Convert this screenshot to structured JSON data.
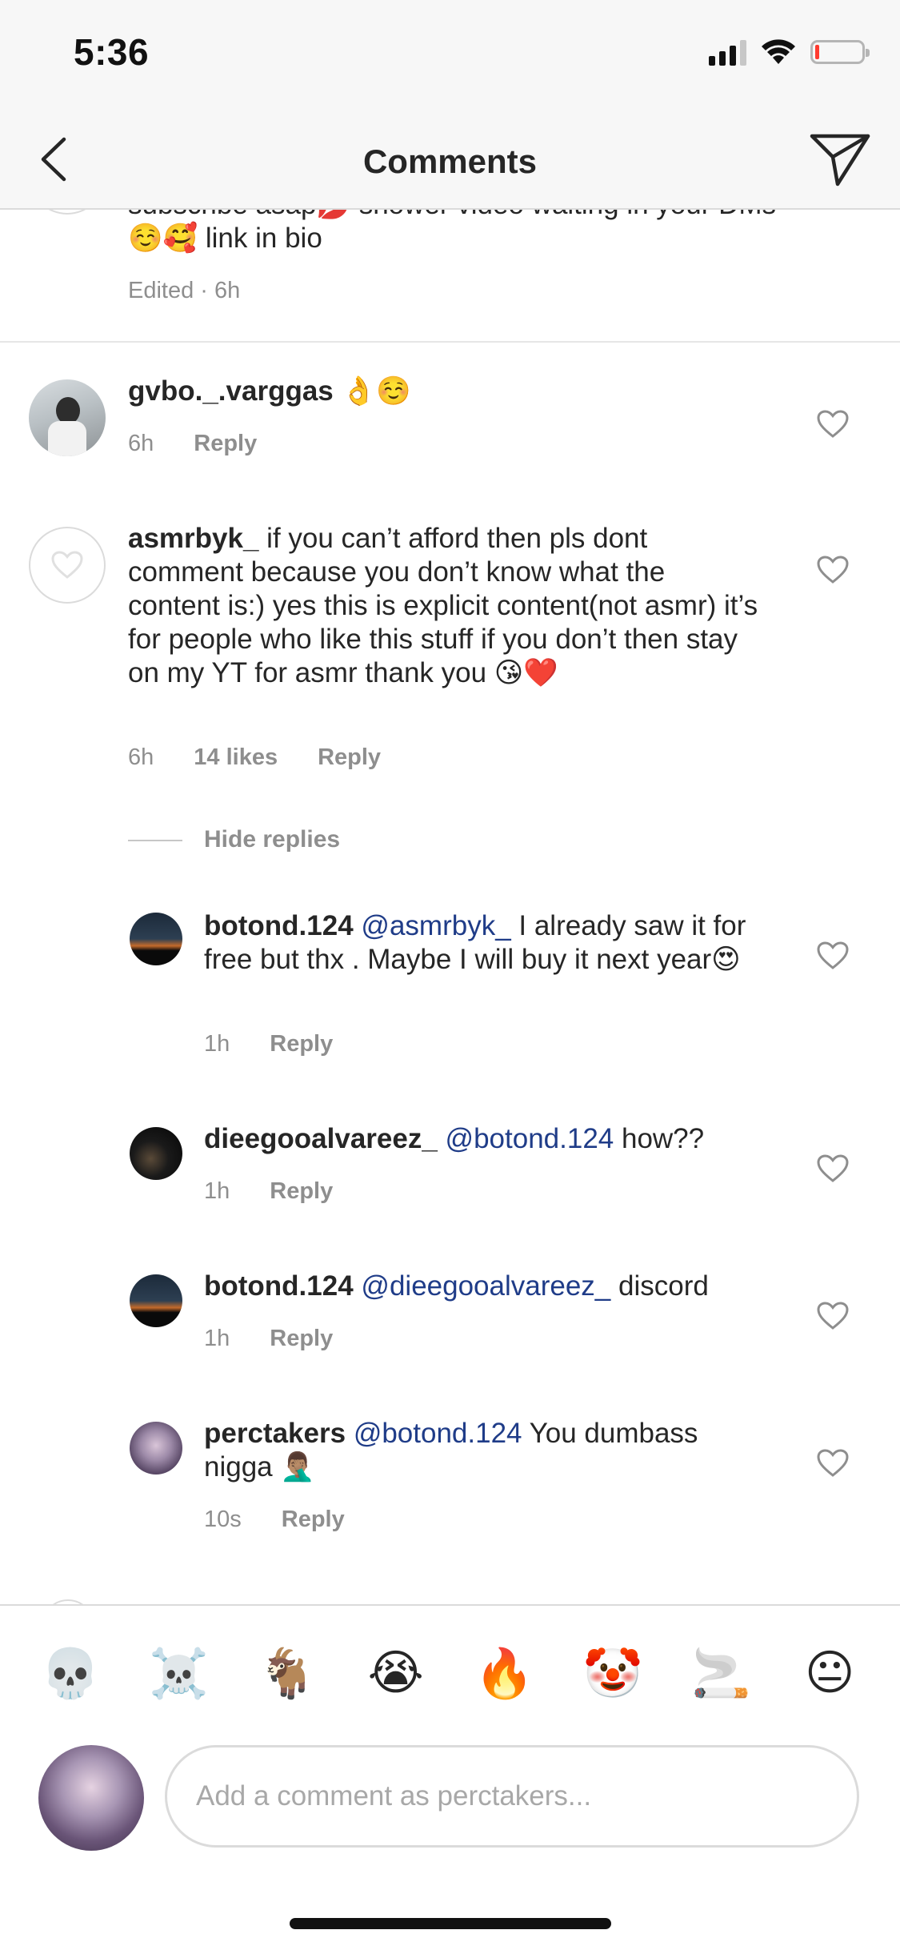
{
  "status_bar": {
    "time": "5:36"
  },
  "nav": {
    "title": "Comments"
  },
  "top_comment": {
    "line_partial": "subscribe asap💋 shower video waiting in your DMs",
    "line2": "☺️🥰 link in bio",
    "meta": "Edited · 6h"
  },
  "comments": [
    {
      "username": "gvbo._.varggas",
      "text": " 👌☺️",
      "time": "6h",
      "reply": "Reply"
    },
    {
      "username": "asmrbyk_",
      "text": " if you can’t afford then pls dont comment because you don’t know what the content is:) yes this is explicit content(not asmr) it’s for people who like this stuff if you don’t then stay on my YT for asmr thank you 😘❤️",
      "time": "6h",
      "likes": "14 likes",
      "reply": "Reply"
    }
  ],
  "hide_replies": "Hide replies",
  "replies": [
    {
      "username": "botond.124",
      "mention": "@asmrbyk_",
      "text": " I already saw it for free but thx . Maybe I will buy it next year😍",
      "time": "1h",
      "reply": "Reply"
    },
    {
      "username": "dieegooalvareez_",
      "mention": "@botond.124",
      "text": " how??",
      "time": "1h",
      "reply": "Reply"
    },
    {
      "username": "botond.124",
      "mention": "@dieegooalvareez_",
      "text": " discord",
      "time": "1h",
      "reply": "Reply"
    },
    {
      "username": "perctakers",
      "mention": "@botond.124",
      "text": " You dumbass nigga 🤦🏽‍♂️",
      "time": "10s",
      "reply": "Reply"
    }
  ],
  "emoji_bar": [
    "💀",
    "☠️",
    "🐐",
    "😭",
    "🔥",
    "🤡",
    "🚬",
    "😐"
  ],
  "input": {
    "placeholder": "Add a comment as perctakers..."
  },
  "icons": {
    "back": "chevron-left-icon",
    "send": "paper-plane-icon",
    "heart": "heart-outline-icon"
  },
  "colors": {
    "mention": "#1f3c88",
    "secondary_text": "#8e8e8e",
    "battery_low": "#ff3b30"
  }
}
